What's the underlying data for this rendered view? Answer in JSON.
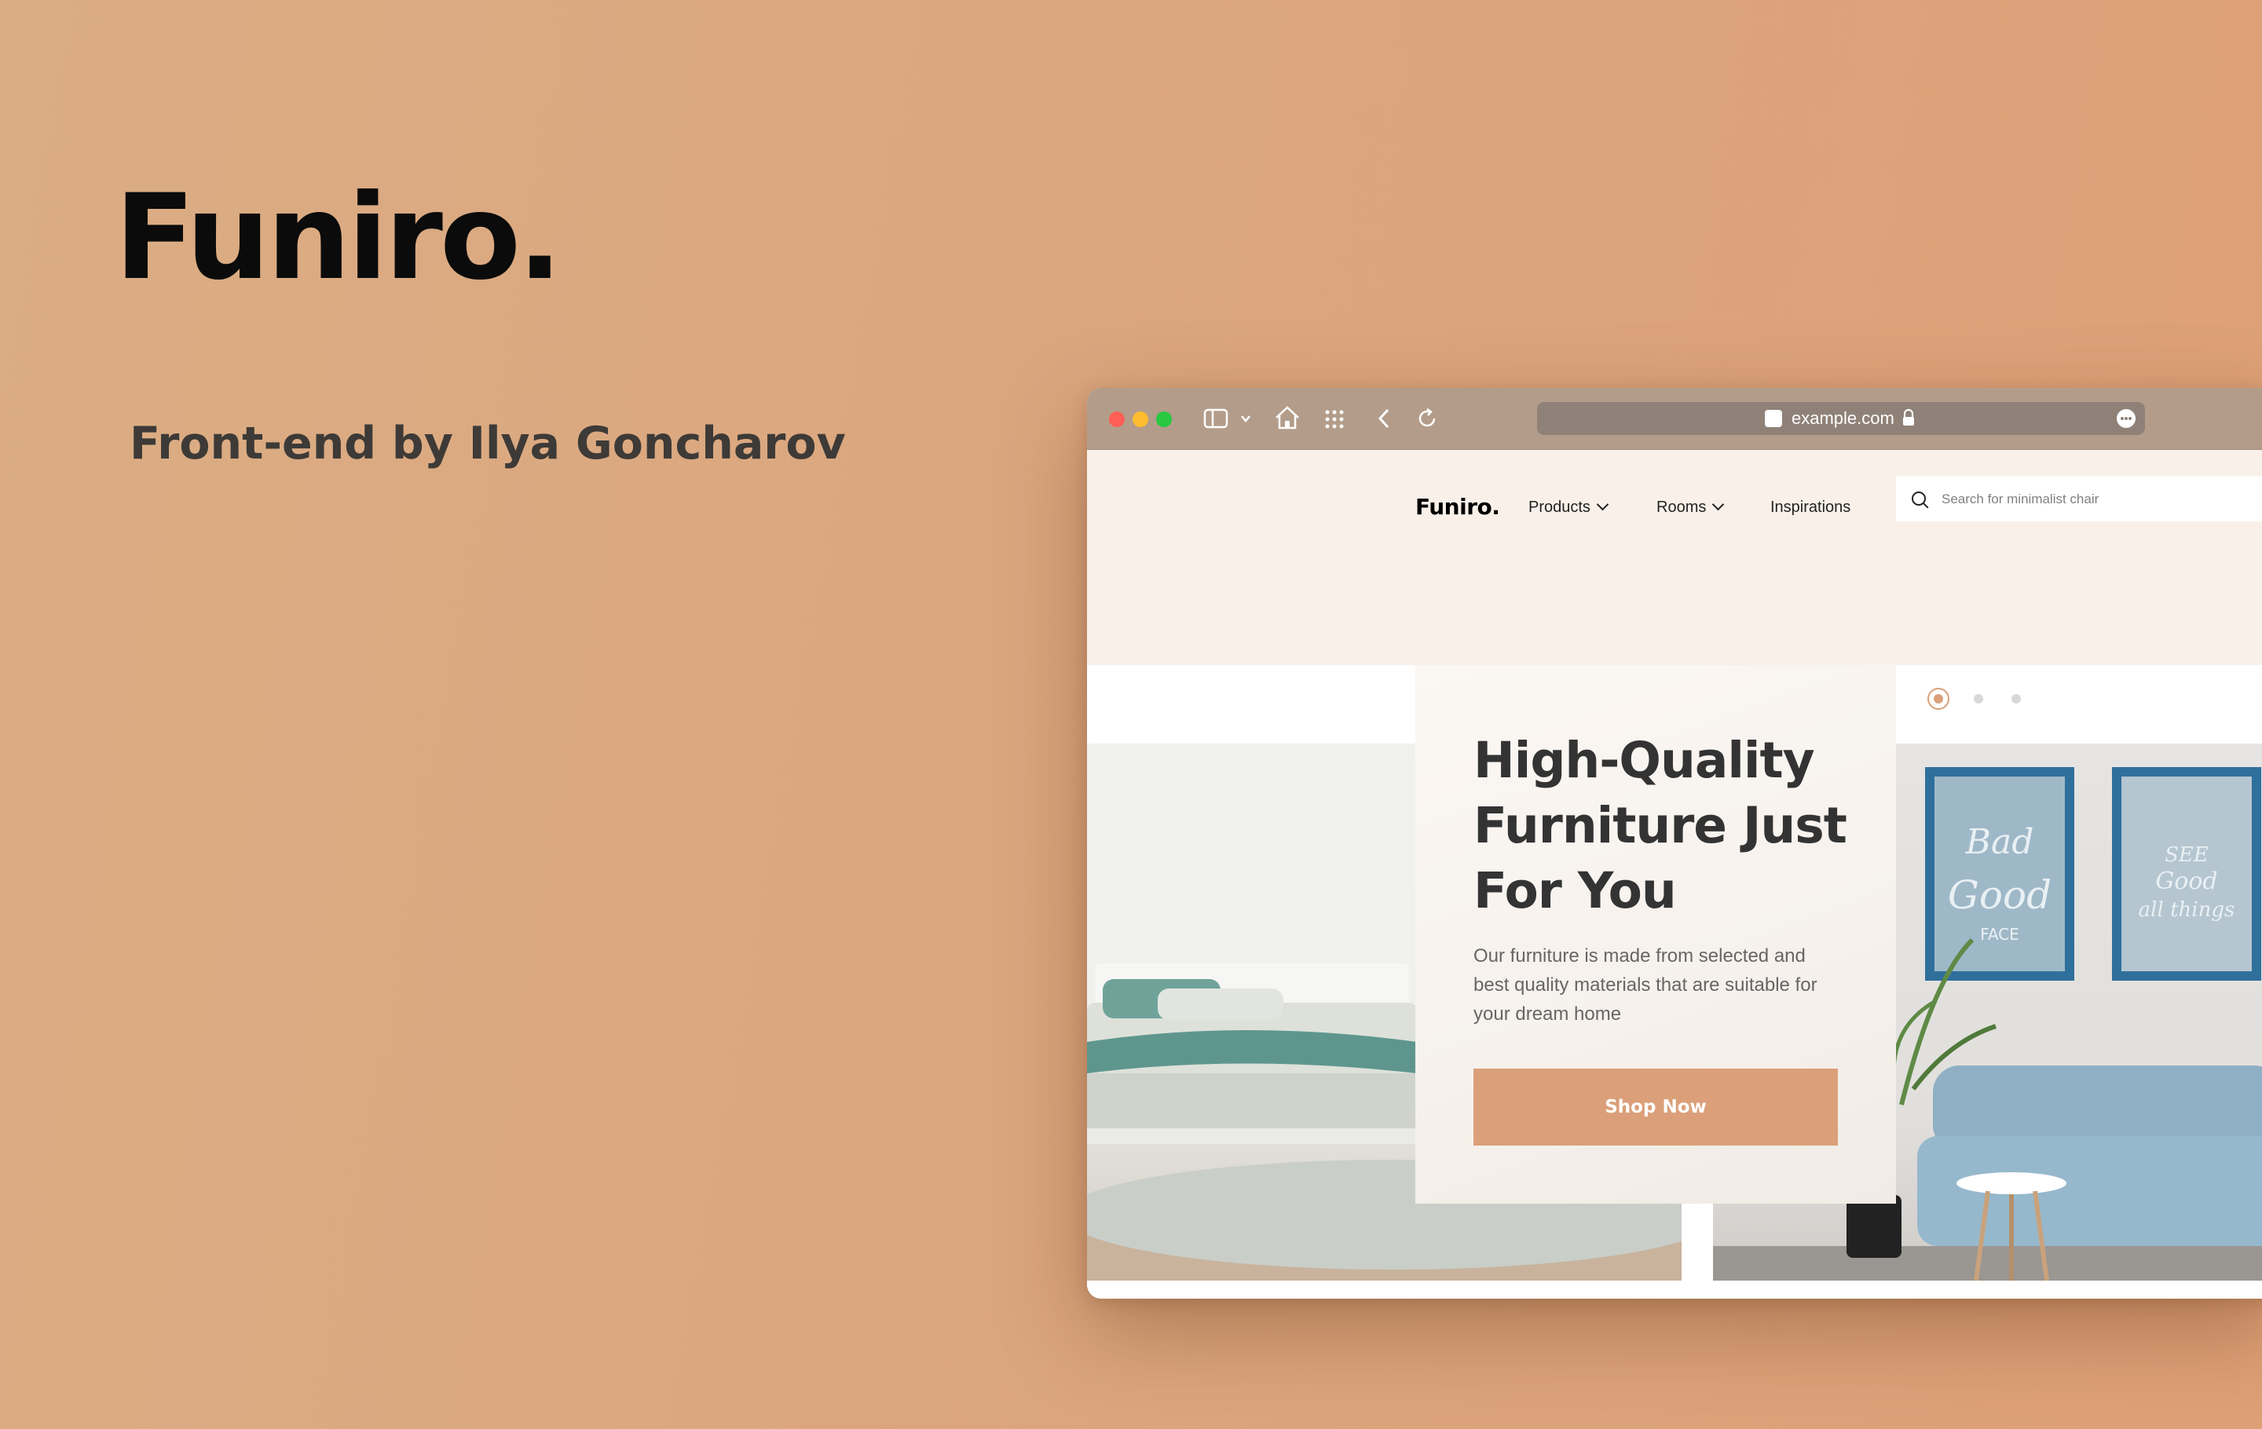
{
  "intro": {
    "title": "Funiro.",
    "subtitle": "Front-end by Ilya Goncharov"
  },
  "browser": {
    "url": "example.com",
    "traffic_light_colors": [
      "#ff5f57",
      "#febc2e",
      "#28c840"
    ],
    "toolbar_icons": [
      "sidebar-icon",
      "chevron-down-icon",
      "home-icon",
      "grid-icon",
      "back-icon",
      "reload-icon"
    ]
  },
  "site": {
    "logo": "Funiro.",
    "nav": [
      "Products",
      "Rooms",
      "Inspirations"
    ],
    "search_placeholder": "Search for minimalist chair",
    "hero": {
      "title": "High-Quality Furniture Just For You",
      "description": "Our furniture is made from selected and best quality materials that are suitable for your dream home",
      "cta": "Shop Now"
    },
    "carousel": {
      "slides": 3,
      "active": 1
    },
    "posters": [
      "Bad Good FACE",
      "SEE Good all things"
    ],
    "colors": {
      "accent": "#dba07a",
      "hero_bg": "#f9f1e9",
      "heading": "#333333"
    }
  }
}
